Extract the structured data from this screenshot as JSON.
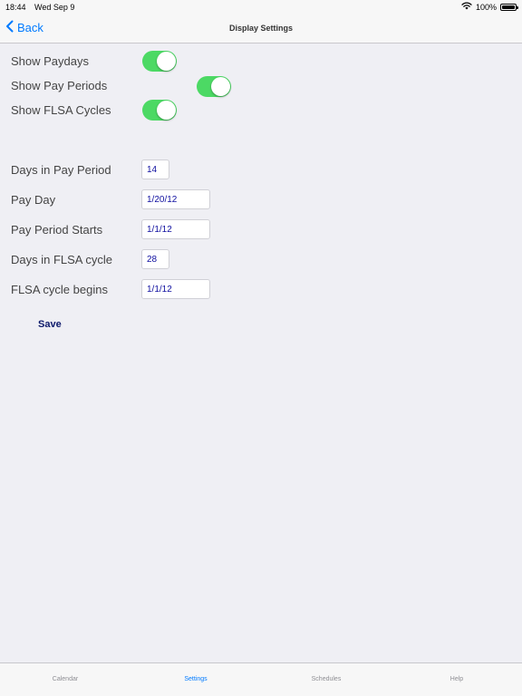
{
  "status_bar": {
    "time": "18:44",
    "date": "Wed Sep 9",
    "battery": "100%",
    "wifi_icon": "wifi-icon",
    "battery_icon": "battery-icon"
  },
  "nav": {
    "back_label": "Back",
    "title": "Display Settings"
  },
  "toggles": [
    {
      "label": "Show Paydays",
      "on": true
    },
    {
      "label": "Show Pay Periods",
      "on": true
    },
    {
      "label": "Show FLSA Cycles",
      "on": true
    }
  ],
  "fields": [
    {
      "label": "Days in Pay Period",
      "value": "14"
    },
    {
      "label": "Pay Day",
      "value": "1/20/12"
    },
    {
      "label": "Pay Period Starts",
      "value": "1/1/12"
    },
    {
      "label": "Days in FLSA cycle",
      "value": "28"
    },
    {
      "label": "FLSA cycle begins",
      "value": "1/1/12"
    }
  ],
  "save_label": "Save",
  "tabs": [
    {
      "label": "Calendar"
    },
    {
      "label": "Settings"
    },
    {
      "label": "Schedules"
    },
    {
      "label": "Help"
    }
  ],
  "active_tab": "Settings",
  "colors": {
    "accent": "#007aff",
    "toggle_on": "#4cd964",
    "field_text": "#1010a0",
    "save": "#0d1a6b"
  }
}
